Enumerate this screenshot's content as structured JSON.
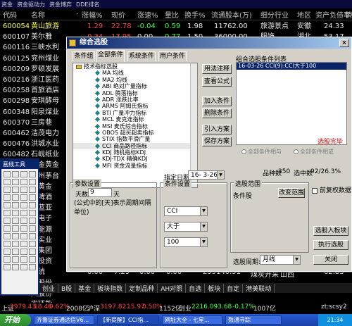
{
  "menu": [
    "资金",
    "资金驱动力",
    "资金博弈",
    "DDE排名"
  ],
  "table": {
    "headers": [
      "代码",
      "名称",
      "·",
      "涨幅%",
      "现价",
      "涨速%",
      "量比",
      "换手%",
      "流通股本(万)",
      "细分行业",
      "地区",
      "资产负债率%",
      "销"
    ],
    "rows": [
      {
        "code": "600054",
        "name": "黄山旅游",
        "chg": "1.29",
        "price": "22.78",
        "speed": "-0.04",
        "vr": "0.59",
        "turn": "1.98",
        "float": "11762.00",
        "industry": "旅游景点",
        "region": "安徽",
        "debt": "24.33"
      },
      {
        "code": "600107",
        "name": "美尔雅",
        "chg": "0.34",
        "price": "17.95",
        "speed": "0.00",
        "vr": "0.77",
        "turn": "1.50",
        "float": "36000.00",
        "industry": "服饰",
        "region": "湖北",
        "debt": "53.17"
      },
      {
        "code": "600116",
        "name": "三峡水利"
      },
      {
        "code": "600125",
        "name": "兖州煤业"
      },
      {
        "code": "600209",
        "name": "罗顿发展"
      },
      {
        "code": "600216",
        "name": "浙江医药"
      },
      {
        "code": "600258",
        "name": "首旅酒店"
      },
      {
        "code": "600298",
        "name": "安琪酵母"
      },
      {
        "code": "600348",
        "name": "阳泉煤业"
      },
      {
        "code": "600370",
        "name": "三房巷"
      },
      {
        "code": "600462",
        "name": "洁茂电力"
      },
      {
        "code": "600476",
        "name": "洪城水业"
      },
      {
        "code": "600482",
        "name": "石岘纸业"
      },
      {
        "code": "600489",
        "name": "中金黄金"
      },
      {
        "code": "600519",
        "name": "贵州茅台"
      },
      {
        "code": "",
        "name": "东黄金"
      },
      {
        "code": "",
        "name": "青啤酒"
      },
      {
        "code": "",
        "name": "连蓝亚"
      },
      {
        "code": "",
        "name": "电电子"
      },
      {
        "code": "",
        "name": "通能源"
      },
      {
        "code": "",
        "name": "极实业"
      },
      {
        "code": "",
        "name": "百集团"
      },
      {
        "code": "",
        "name": "宿投资"
      },
      {
        "code": "",
        "name": "宜统"
      },
      {
        "code": "",
        "name": "彭股份"
      },
      {
        "code": "",
        "name": "天股份"
      },
      {
        "code": "",
        "name": "安环能"
      }
    ],
    "last_row": {
      "chg": "0.00",
      "price": "7.29",
      "speed": "0.00",
      "vr": "0.00",
      "float": "299140.91",
      "industry": "煤炭开采",
      "region": "山西",
      "debt": "62.83"
    }
  },
  "bottom_tabs": [
    "创业",
    "B股",
    "基金",
    "板块指数",
    "定制品种",
    "AH对照",
    "自选",
    "板块",
    "自定",
    "港美联动"
  ],
  "index_bar": {
    "sh_label": "上证",
    "sh_value": "2979.43",
    "sh_chg": "18.46",
    "sh_pct": "0.62%",
    "sh_amount": "2008亿",
    "sz_label": "沪深",
    "sz_value": "3197.82",
    "sz_chg": "15.97",
    "sz_pct": "0.50%",
    "sz_amount": "1152亿",
    "cy_label": "创业",
    "cy_value": "2216.09",
    "cy_chg": "-3.68",
    "cy_pct": "-0.17%",
    "cy_amount": "1007亿",
    "tail": "zt:scsy2"
  },
  "taskbar": {
    "start": "开始",
    "tasks": [
      "齐鲁证券通达信V6...",
      "【新提醒】CCI指...",
      "网址大全 - 七星...",
      "数通寻踪"
    ],
    "clock": "21:34"
  },
  "toolbox": {
    "title": "画线工具"
  },
  "dialog": {
    "title": "综合选股",
    "close": "×",
    "tabs": [
      "条件组",
      "全部条件",
      "系统条件",
      "用户条件"
    ],
    "tree_items": [
      {
        "type": "folder",
        "label": "技术指标选股"
      },
      {
        "type": "leaf",
        "label": "MA 均线"
      },
      {
        "type": "leaf",
        "label": "MA2 均线"
      },
      {
        "type": "leaf",
        "label": "ABI 绝对广量指标"
      },
      {
        "type": "leaf",
        "label": "ADL 腾落指标"
      },
      {
        "type": "leaf",
        "label": "ADR 涨跌比率"
      },
      {
        "type": "leaf",
        "label": "ARMS 阿姆氏指标"
      },
      {
        "type": "leaf",
        "label": "BTI 广量冲力指标"
      },
      {
        "type": "leaf",
        "label": "MCL 麦克连指标"
      },
      {
        "type": "leaf",
        "label": "MSI 麦氏综合指标"
      },
      {
        "type": "leaf",
        "label": "OBOS 超买超卖指标"
      },
      {
        "type": "leaf",
        "label": "STIX 指数平滑广量"
      },
      {
        "type": "leaf",
        "label": "CCI 商品路径指标"
      },
      {
        "type": "leaf",
        "label": "KDJ 随机指标KDJ"
      },
      {
        "type": "leaf",
        "label": "KDJ-TDX 精确KDJ"
      },
      {
        "type": "leaf",
        "label": "MFI 资金流量指标"
      }
    ],
    "btn_usage": "用法注释",
    "btn_view_formula": "查看公式",
    "btn_add": "加入条件",
    "btn_delete": "删除条件",
    "btn_import": "引入方案",
    "btn_save": "保存方案",
    "list_title": "组合选股条件列表",
    "list_item": "16-03-26 CCI(9):CCI大于100",
    "status_done": "选股完毕",
    "radio_all": "全部条件相与",
    "radio_any": "全部条件相或",
    "count_label": "品种数",
    "count_value": "350",
    "ratio_label": "选中数",
    "ratio_value": "92/26.3%",
    "params_title": "参数设置",
    "days_label": "天数:",
    "days_value": "9",
    "days_unit": "天",
    "params_note": "(公式中的[天]表示周期间隔单位)",
    "cond_title": "条件设置",
    "date_label": "指定日期:",
    "date_value": "16- 3-26",
    "combo_indicator": "CCI",
    "combo_op": "大于",
    "combo_value": "100",
    "range_title": "选股范围",
    "range_label": "选股范围",
    "range_value": "条件股",
    "btn_change_range": "改变范围",
    "checkbox_prerights": "前复权数据",
    "btn_to_board": "选股入板块",
    "btn_run": "执行选股",
    "period_label": "选股周期:",
    "period_value": "月线",
    "btn_close": "关闭"
  }
}
